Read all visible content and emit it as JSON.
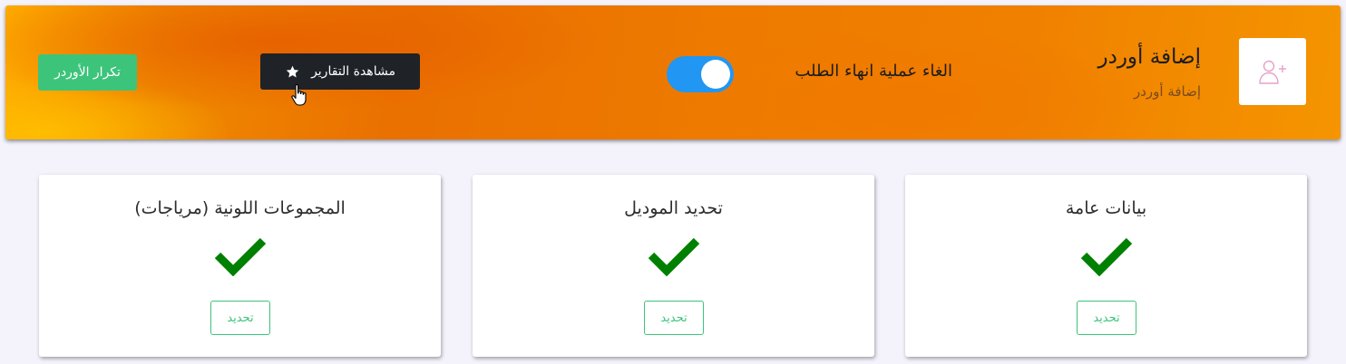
{
  "header": {
    "title": "إضافة أوردر",
    "subtitle": "إضافة أوردر",
    "avatar_icon": "add-user-icon",
    "toggle_label": "الغاء عملية انهاء الطلب",
    "toggle_on": true,
    "reports_button": "مشاهدة التقارير",
    "reports_icon": "star-icon",
    "repeat_button": "تكرار الأوردر"
  },
  "cards": [
    {
      "title": "بيانات عامة",
      "status_icon": "check-icon",
      "button": "تحديد"
    },
    {
      "title": "تحديد الموديل",
      "status_icon": "check-icon",
      "button": "تحديد"
    },
    {
      "title": "المجموعات اللونية (مرياجات)",
      "status_icon": "check-icon",
      "button": "تحديد"
    }
  ],
  "colors": {
    "header_orange": "#ee7b00",
    "toggle_blue": "#2196f3",
    "accent_green": "#3cc47a",
    "check_green": "#008000",
    "dark_button": "#1f2328"
  }
}
